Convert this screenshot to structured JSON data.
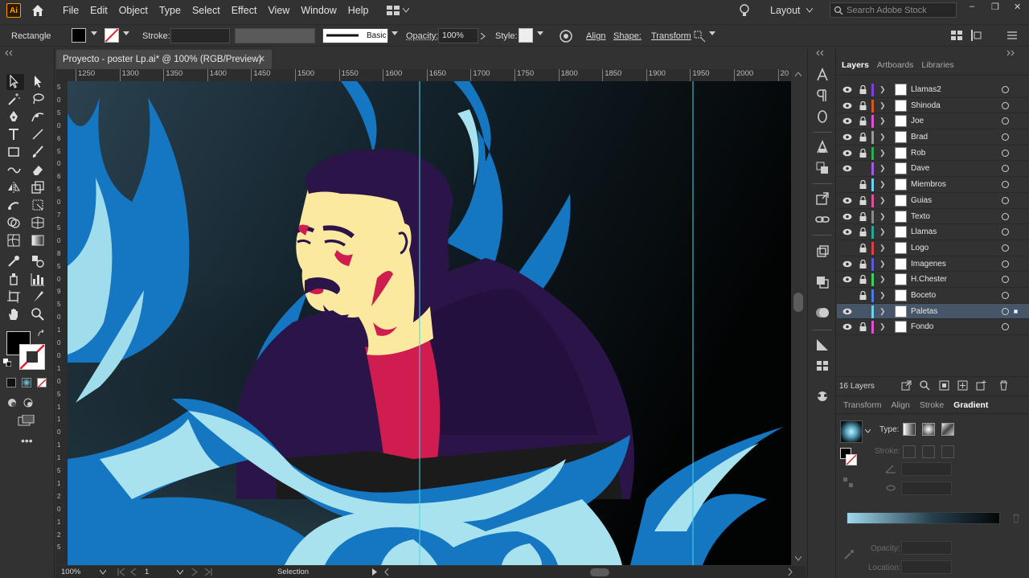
{
  "app": {
    "logo_text": "Ai"
  },
  "menu": [
    "File",
    "Edit",
    "Object",
    "Type",
    "Select",
    "Effect",
    "View",
    "Window",
    "Help"
  ],
  "workspace": {
    "label": "Layout"
  },
  "stock_search": {
    "placeholder": "Search Adobe Stock"
  },
  "window_controls": {
    "minimize": "–",
    "restore": "❐",
    "close": "✕"
  },
  "controlbar": {
    "tool_name": "Rectangle",
    "stroke_label": "Stroke:",
    "brush_label": "Basic",
    "opacity_label": "Opacity:",
    "opacity_value": "100%",
    "style_label": "Style:",
    "align_label": "Align",
    "shape_label": "Shape:",
    "transform_label": "Transform"
  },
  "document": {
    "tab_title": "Proyecto - poster Lp.ai* @ 100% (RGB/Preview)",
    "close": "✕"
  },
  "ruler": {
    "h_ticks": [
      "1250",
      "1300",
      "1350",
      "1400",
      "1450",
      "1500",
      "1550",
      "1600",
      "1650",
      "1700",
      "1750",
      "1800",
      "1850",
      "1900",
      "1950",
      "2000",
      "20"
    ],
    "v_ticks": [
      "5",
      "0",
      "5",
      "0",
      "6",
      "5",
      "0",
      "6",
      "5",
      "0",
      "7",
      "5",
      "0",
      "8",
      "5",
      "0",
      "9",
      "5",
      "0",
      "1",
      "0",
      "0",
      "1",
      "0",
      "5",
      "1",
      "1",
      "0",
      "1",
      "1",
      "5",
      "1",
      "2",
      "0",
      "1",
      "2",
      "5"
    ]
  },
  "panels": {
    "layer_tabs": [
      "Layers",
      "Artboards",
      "Libraries"
    ],
    "layers": [
      {
        "name": "Llamas2",
        "color": "#7f3fe0",
        "visible": true,
        "locked": true
      },
      {
        "name": "Shinoda",
        "color": "#d25a1e",
        "visible": true,
        "locked": true
      },
      {
        "name": "Joe",
        "color": "#e04fd2",
        "visible": true,
        "locked": true
      },
      {
        "name": "Brad",
        "color": "#9a9a9a",
        "visible": true,
        "locked": true
      },
      {
        "name": "Rob",
        "color": "#2bb04a",
        "visible": true,
        "locked": true
      },
      {
        "name": "Dave",
        "color": "#a35ae0",
        "visible": true,
        "locked": false
      },
      {
        "name": "Miembros",
        "color": "#6fd0f0",
        "visible": false,
        "locked": true
      },
      {
        "name": "Guias",
        "color": "#e04f9a",
        "visible": true,
        "locked": true
      },
      {
        "name": "Texto",
        "color": "#8a8a8a",
        "visible": true,
        "locked": true
      },
      {
        "name": "Llamas",
        "color": "#2aa59a",
        "visible": true,
        "locked": true
      },
      {
        "name": "Logo",
        "color": "#e0413f",
        "visible": false,
        "locked": true
      },
      {
        "name": "Imagenes",
        "color": "#5a5ae0",
        "visible": true,
        "locked": true
      },
      {
        "name": "H.Chester",
        "color": "#3fd05a",
        "visible": true,
        "locked": true
      },
      {
        "name": "Boceto",
        "color": "#4f7ae0",
        "visible": false,
        "locked": true
      },
      {
        "name": "Paletas",
        "color": "#6fd0f0",
        "visible": true,
        "locked": false,
        "selected": true
      },
      {
        "name": "Fondo",
        "color": "#e04fd2",
        "visible": true,
        "locked": true
      }
    ],
    "layer_count": "16 Layers",
    "gradient_tabs": [
      "Transform",
      "Align",
      "Stroke",
      "Gradient"
    ],
    "gradient": {
      "type_label": "Type:",
      "stroke_label": "Stroke:",
      "opacity_label": "Opacity:",
      "location_label": "Location:"
    }
  },
  "status": {
    "zoom": "100%",
    "artboard": "1",
    "tool": "Selection"
  },
  "colors": {
    "ui_bg": "#323232",
    "selected_layer": "#465567",
    "accent_orange": "#ff9a00",
    "flame_blue": "#1577c2",
    "flame_light": "#a8e2ee",
    "skin": "#fbe9a0",
    "shirt": "#d01d4f",
    "jacket": "#2b1448"
  }
}
